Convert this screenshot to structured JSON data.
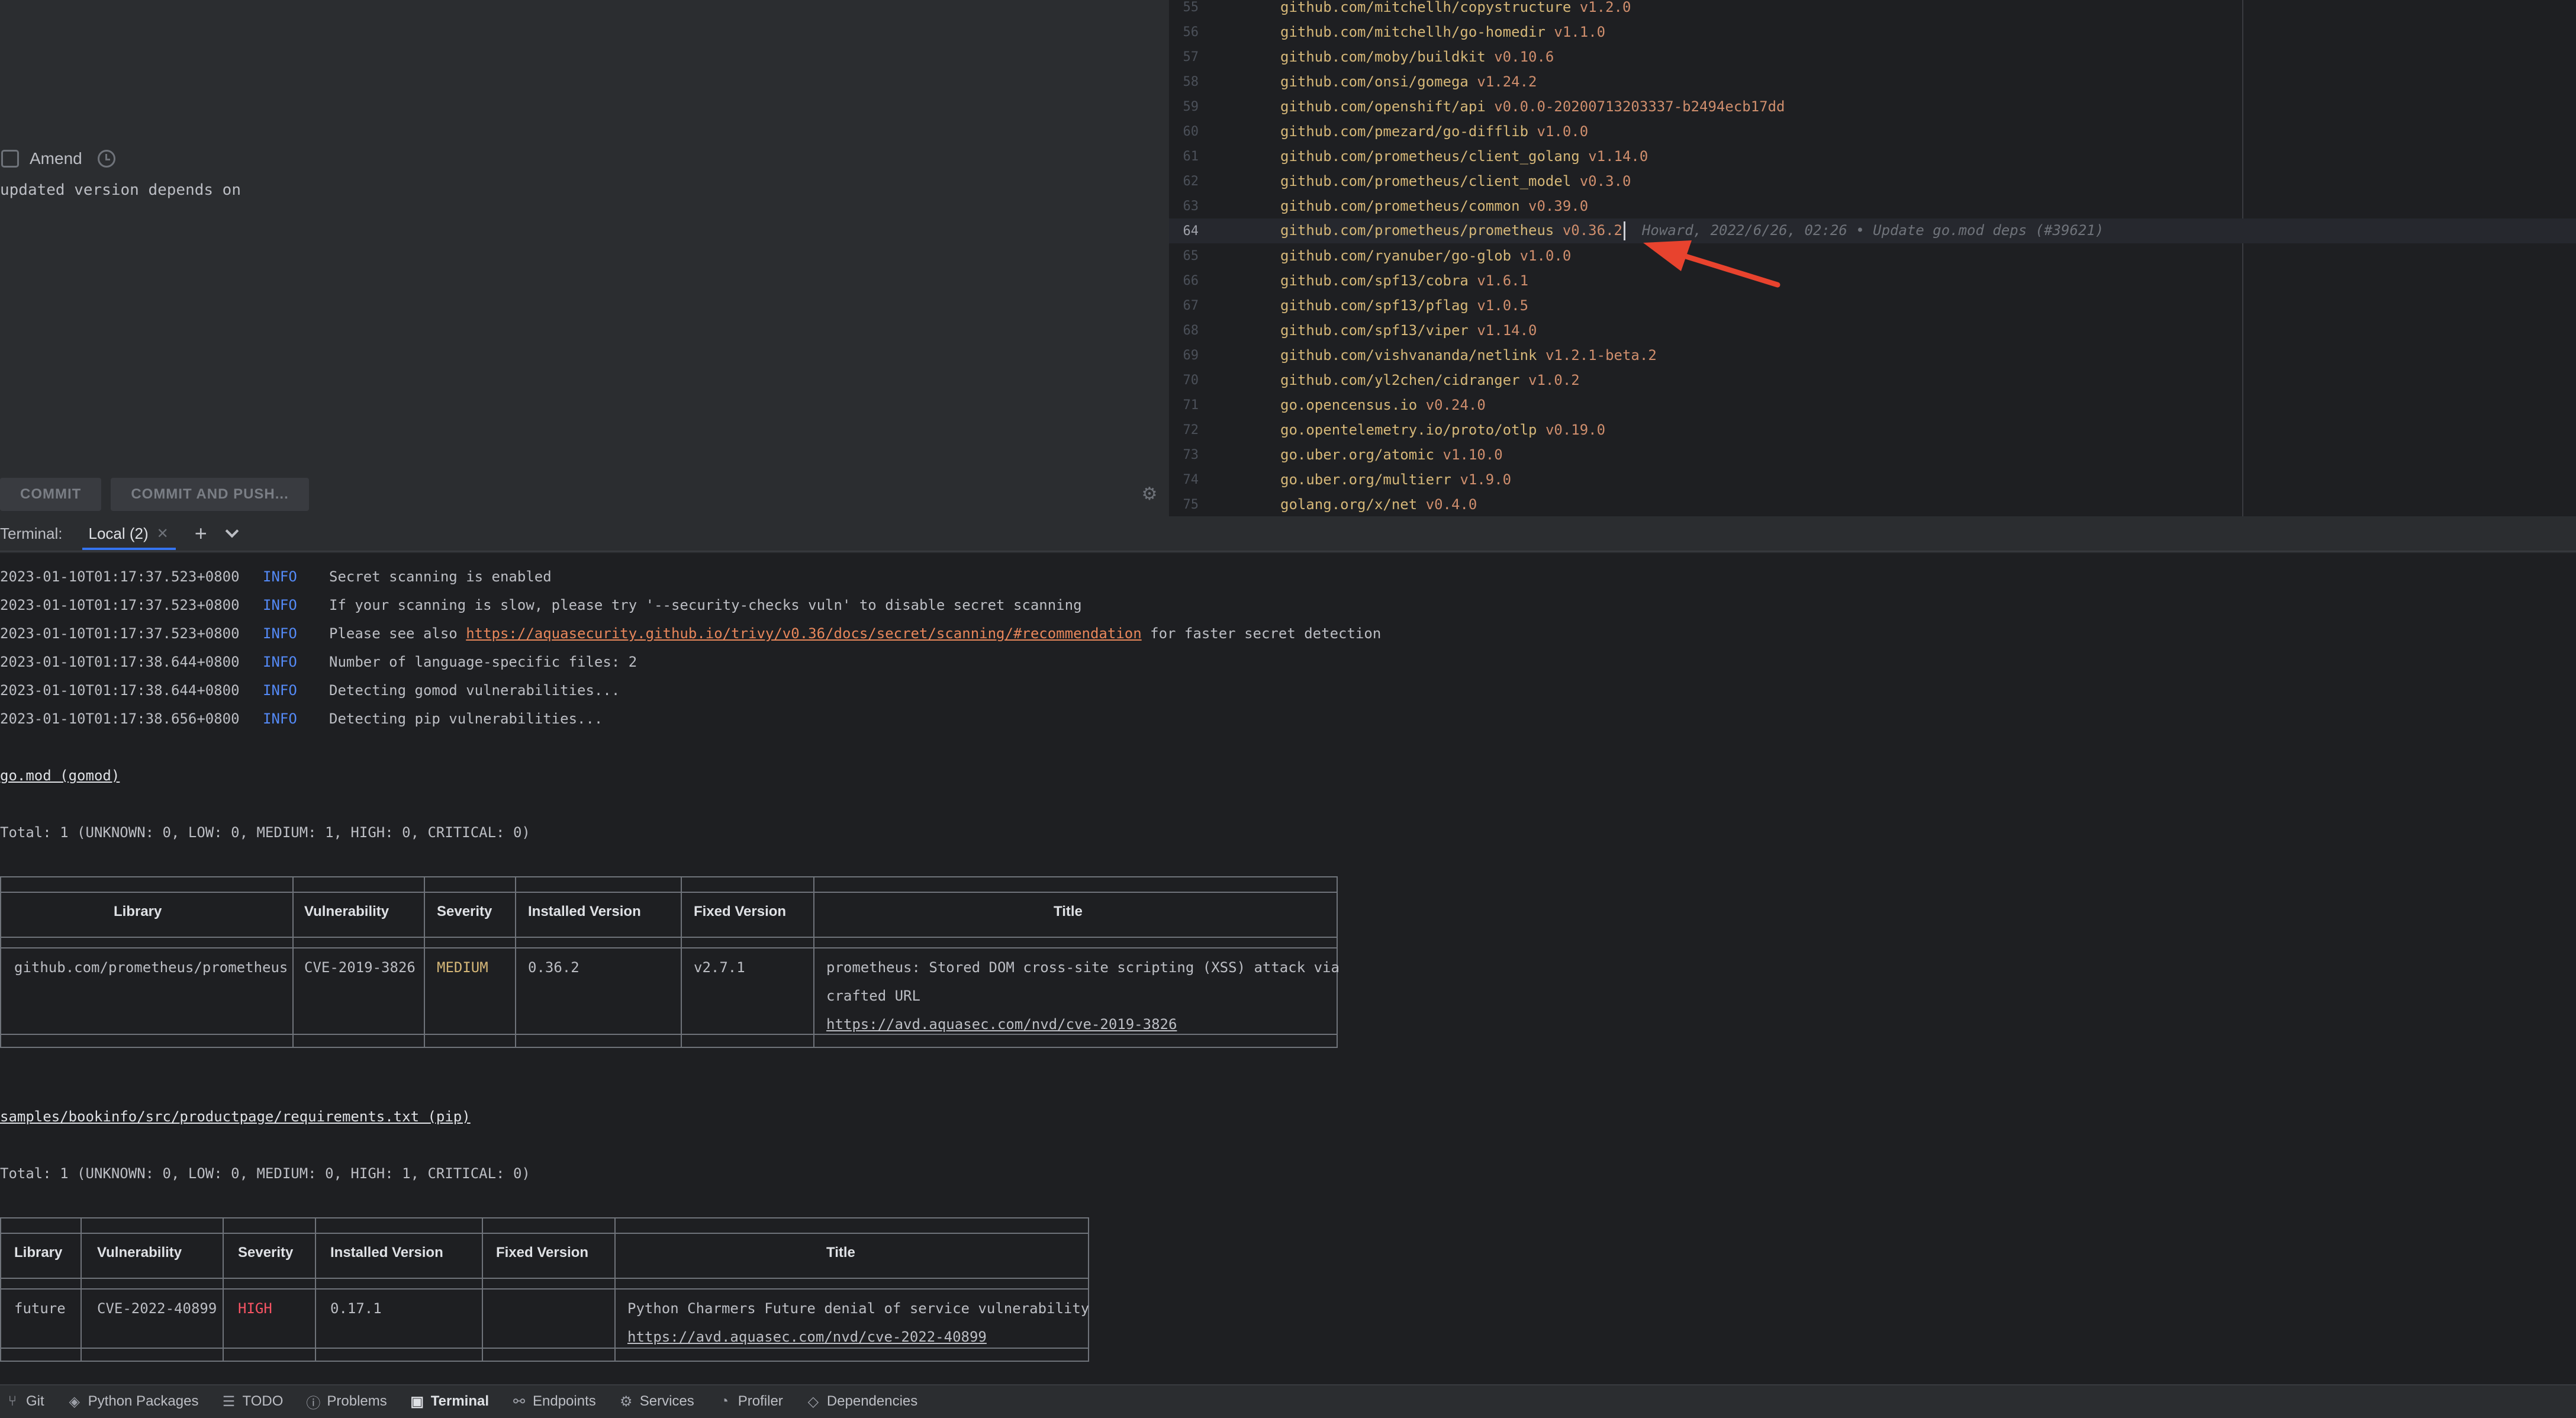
{
  "commit_panel": {
    "amend_label": "Amend",
    "message": "updated version depends on",
    "commit_button": "COMMIT",
    "commit_push_button": "COMMIT AND PUSH..."
  },
  "editor": {
    "lines": [
      {
        "num": "55",
        "module": "github.com/mitchellh/copystructure",
        "version": "v1.2.0"
      },
      {
        "num": "56",
        "module": "github.com/mitchellh/go-homedir",
        "version": "v1.1.0"
      },
      {
        "num": "57",
        "module": "github.com/moby/buildkit",
        "version": "v0.10.6"
      },
      {
        "num": "58",
        "module": "github.com/onsi/gomega",
        "version": "v1.24.2"
      },
      {
        "num": "59",
        "module": "github.com/openshift/api",
        "version": "v0.0.0-20200713203337-b2494ecb17dd"
      },
      {
        "num": "60",
        "module": "github.com/pmezard/go-difflib",
        "version": "v1.0.0"
      },
      {
        "num": "61",
        "module": "github.com/prometheus/client_golang",
        "version": "v1.14.0"
      },
      {
        "num": "62",
        "module": "github.com/prometheus/client_model",
        "version": "v0.3.0"
      },
      {
        "num": "63",
        "module": "github.com/prometheus/common",
        "version": "v0.39.0"
      },
      {
        "num": "64",
        "module": "github.com/prometheus/prometheus",
        "version": "v0.36.2",
        "blame": "Howard, 2022/6/26, 02:26 • Update go.mod deps (#39621)"
      },
      {
        "num": "65",
        "module": "github.com/ryanuber/go-glob",
        "version": "v1.0.0"
      },
      {
        "num": "66",
        "module": "github.com/spf13/cobra",
        "version": "v1.6.1"
      },
      {
        "num": "67",
        "module": "github.com/spf13/pflag",
        "version": "v1.0.5"
      },
      {
        "num": "68",
        "module": "github.com/spf13/viper",
        "version": "v1.14.0"
      },
      {
        "num": "69",
        "module": "github.com/vishvananda/netlink",
        "version": "v1.2.1-beta.2"
      },
      {
        "num": "70",
        "module": "github.com/yl2chen/cidranger",
        "version": "v1.0.2"
      },
      {
        "num": "71",
        "module": "go.opencensus.io",
        "version": "v0.24.0"
      },
      {
        "num": "72",
        "module": "go.opentelemetry.io/proto/otlp",
        "version": "v0.19.0"
      },
      {
        "num": "73",
        "module": "go.uber.org/atomic",
        "version": "v1.10.0"
      },
      {
        "num": "74",
        "module": "go.uber.org/multierr",
        "version": "v1.9.0"
      },
      {
        "num": "75",
        "module": "golang.org/x/net",
        "version": "v0.4.0"
      }
    ]
  },
  "terminal": {
    "title": "Terminal:",
    "tab_label": "Local (2)",
    "logs": [
      {
        "ts": "2023-01-10T01:17:37.523+0800",
        "level": "INFO",
        "msg": "Secret scanning is enabled"
      },
      {
        "ts": "2023-01-10T01:17:37.523+0800",
        "level": "INFO",
        "msg": "If your scanning is slow, please try '--security-checks vuln' to disable secret scanning"
      },
      {
        "ts": "2023-01-10T01:17:37.523+0800",
        "level": "INFO",
        "msg": "Please see also ",
        "link": "https://aquasecurity.github.io/trivy/v0.36/docs/secret/scanning/#recommendation",
        "msg_after": " for faster secret detection"
      },
      {
        "ts": "2023-01-10T01:17:38.644+0800",
        "level": "INFO",
        "msg": "Number of language-specific files: 2"
      },
      {
        "ts": "2023-01-10T01:17:38.644+0800",
        "level": "INFO",
        "msg": "Detecting gomod vulnerabilities..."
      },
      {
        "ts": "2023-01-10T01:17:38.656+0800",
        "level": "INFO",
        "msg": "Detecting pip vulnerabilities..."
      }
    ],
    "section1": {
      "heading": "go.mod (gomod)",
      "total": "Total: 1 (UNKNOWN: 0, LOW: 0, MEDIUM: 1, HIGH: 0, CRITICAL: 0)",
      "headers": [
        "Library",
        "Vulnerability",
        "Severity",
        "Installed Version",
        "Fixed Version",
        "Title"
      ],
      "row": {
        "library": "github.com/prometheus/prometheus",
        "vulnerability": "CVE-2019-3826",
        "severity": "MEDIUM",
        "installed": "0.36.2",
        "fixed": "v2.7.1",
        "title_line1": "prometheus: Stored DOM cross-site scripting (XSS) attack via",
        "title_line2": "crafted URL",
        "title_link": "https://avd.aquasec.com/nvd/cve-2019-3826"
      }
    },
    "section2": {
      "heading": "samples/bookinfo/src/productpage/requirements.txt (pip)",
      "total": "Total: 1 (UNKNOWN: 0, LOW: 0, MEDIUM: 0, HIGH: 1, CRITICAL: 0)",
      "headers": [
        "Library",
        "Vulnerability",
        "Severity",
        "Installed Version",
        "Fixed Version",
        "Title"
      ],
      "row": {
        "library": "future",
        "vulnerability": "CVE-2022-40899",
        "severity": "HIGH",
        "installed": "0.17.1",
        "fixed": "",
        "title_line1": "Python Charmers Future denial of service vulnerability",
        "title_link": "https://avd.aquasec.com/nvd/cve-2022-40899"
      }
    }
  },
  "toolbar": {
    "items": [
      {
        "label": "Git",
        "icon": "git-branch-icon"
      },
      {
        "label": "Python Packages",
        "icon": "packages-icon"
      },
      {
        "label": "TODO",
        "icon": "list-icon"
      },
      {
        "label": "Problems",
        "icon": "info-icon"
      },
      {
        "label": "Terminal",
        "icon": "terminal-icon"
      },
      {
        "label": "Endpoints",
        "icon": "endpoints-icon"
      },
      {
        "label": "Services",
        "icon": "services-icon"
      },
      {
        "label": "Profiler",
        "icon": "profiler-icon"
      },
      {
        "label": "Dependencies",
        "icon": "dependencies-icon"
      }
    ]
  },
  "colors": {
    "accent": "#3574f0",
    "annotation_arrow": "#e8432e",
    "medium": "#d5b778",
    "high": "#f75464"
  }
}
